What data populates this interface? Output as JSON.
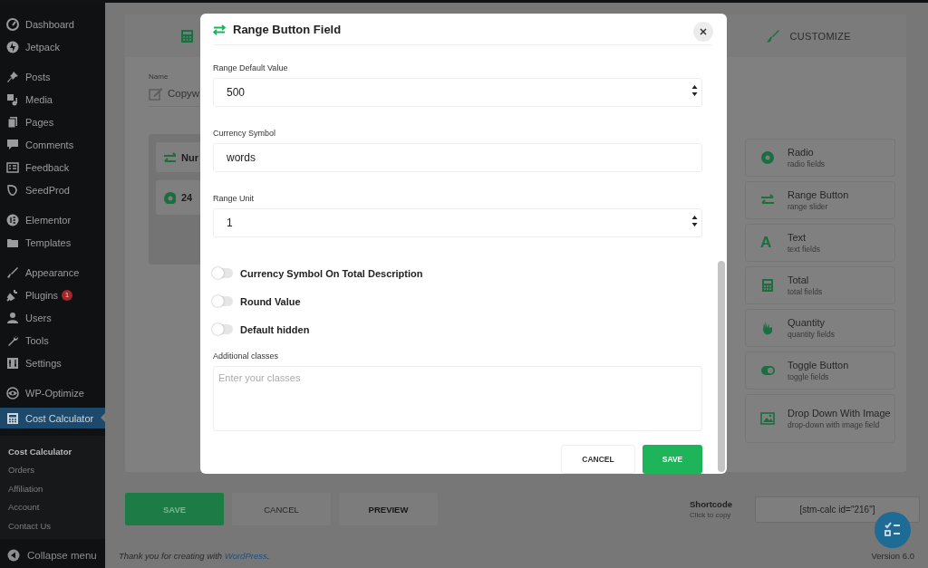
{
  "sidebar": {
    "groups": [
      [
        {
          "label": "Dashboard",
          "selected": false
        },
        {
          "label": "Jetpack",
          "selected": false
        }
      ],
      [
        {
          "label": "Posts",
          "selected": false
        },
        {
          "label": "Media",
          "selected": false
        },
        {
          "label": "Pages",
          "selected": false
        },
        {
          "label": "Comments",
          "selected": false
        },
        {
          "label": "Feedback",
          "selected": false
        },
        {
          "label": "SeedProd",
          "selected": false
        }
      ],
      [
        {
          "label": "Elementor",
          "selected": false
        },
        {
          "label": "Templates",
          "selected": false
        }
      ],
      [
        {
          "label": "Appearance",
          "selected": false
        },
        {
          "label": "Plugins",
          "selected": false,
          "badge": "1"
        },
        {
          "label": "Users",
          "selected": false
        },
        {
          "label": "Tools",
          "selected": false
        },
        {
          "label": "Settings",
          "selected": false
        }
      ],
      [
        {
          "label": "WP-Optimize",
          "selected": false
        },
        {
          "label": "Cost Calculator",
          "selected": true
        }
      ]
    ],
    "submenu": [
      {
        "label": "Cost Calculator",
        "selected": true
      },
      {
        "label": "Orders",
        "selected": false
      },
      {
        "label": "Affiliation",
        "selected": false
      },
      {
        "label": "Account",
        "selected": false
      },
      {
        "label": "Contact Us",
        "selected": false
      }
    ],
    "collapse_label": "Collapse menu"
  },
  "builder": {
    "tabs": [
      {
        "label": "CUSTOMIZE"
      }
    ],
    "name": {
      "label": "Name",
      "value": "Copyw"
    },
    "fields": [
      {
        "label": "Nur"
      },
      {
        "label": "24"
      }
    ],
    "field_types": [
      {
        "title": "Radio",
        "subtitle": "radio fields"
      },
      {
        "title": "Range Button",
        "subtitle": "range slider"
      },
      {
        "title": "Text",
        "subtitle": "text fields",
        "icon_text": "A"
      },
      {
        "title": "Total",
        "subtitle": "total fields"
      },
      {
        "title": "Quantity",
        "subtitle": "quantity fields"
      },
      {
        "title": "Toggle Button",
        "subtitle": "toggle fields"
      },
      {
        "title": "Drop Down With Image",
        "subtitle": "drop-down with image field"
      }
    ],
    "buttons": [
      {
        "label": "SAVE",
        "kind": "primary"
      },
      {
        "label": "CANCEL",
        "kind": "secondary"
      },
      {
        "label": "PREVIEW",
        "kind": "tertiary"
      }
    ],
    "shortcode": {
      "label": "Shortcode",
      "hint": "Click to copy",
      "value": "[stm-calc id=\"216\"]"
    }
  },
  "footer": {
    "text": "Thank you for creating with",
    "link": "WordPress",
    "end": ".",
    "version": "Version 6.0"
  },
  "modal": {
    "title": "Range Button Field",
    "fields": [
      {
        "kind": "number",
        "label": "Range Default Value",
        "value": "500"
      },
      {
        "kind": "text",
        "label": "Currency Symbol",
        "value": "words"
      },
      {
        "kind": "number",
        "label": "Range Unit",
        "value": "1"
      },
      {
        "kind": "toggle",
        "label": "Currency Symbol On Total Description",
        "on": false
      },
      {
        "kind": "toggle",
        "label": "Round Value",
        "on": false
      },
      {
        "kind": "toggle",
        "label": "Default hidden",
        "on": false
      },
      {
        "kind": "textarea",
        "label": "Additional classes",
        "placeholder": "Enter your classes"
      }
    ],
    "buttons": [
      {
        "label": "CANCEL",
        "kind": "secondary"
      },
      {
        "label": "SAVE",
        "kind": "primary"
      }
    ]
  }
}
